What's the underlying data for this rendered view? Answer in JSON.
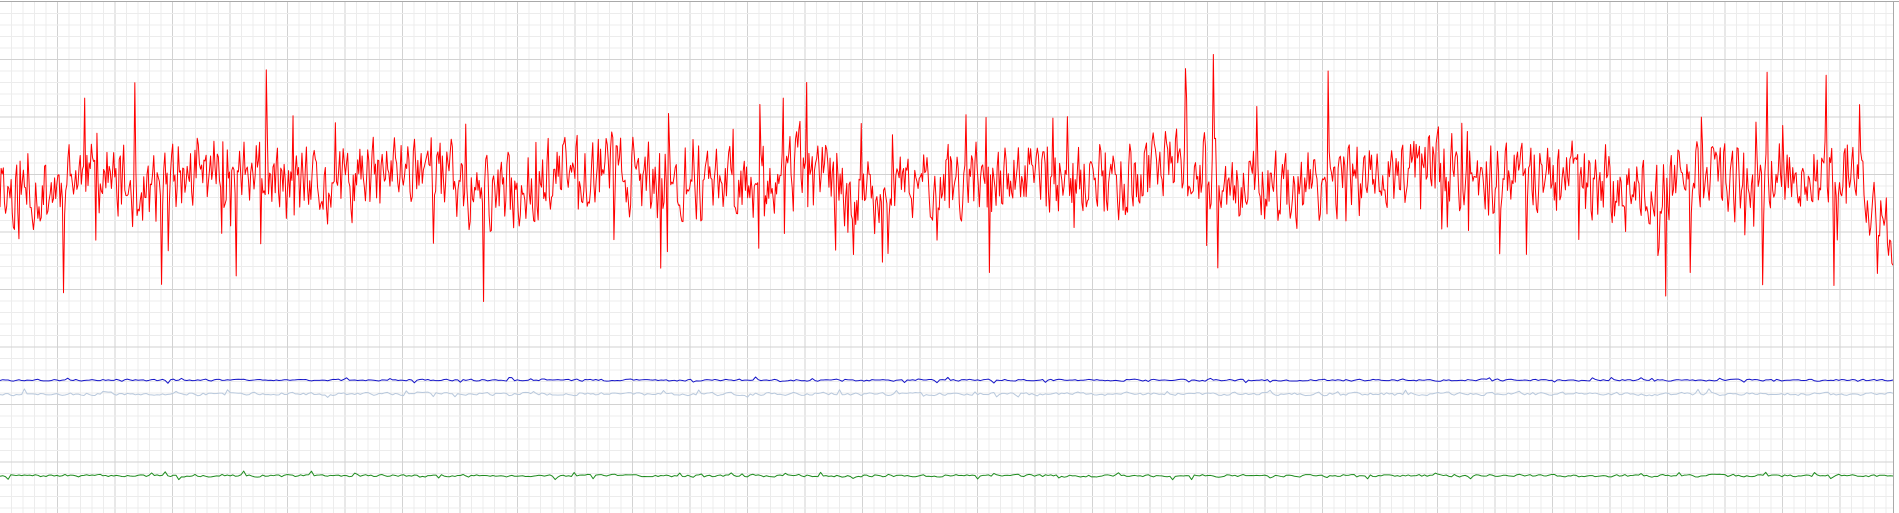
{
  "chart_data": {
    "type": "line",
    "xlabel": "",
    "ylabel": "",
    "xlim": [
      0,
      1000
    ],
    "ylim": [
      0,
      100
    ],
    "grid": true,
    "legend": "none",
    "colors": {
      "grid_minor": "#ececec",
      "grid_major": "#d2d2d2",
      "frame": "#a9a9a9"
    },
    "series": [
      {
        "color": "#ff0000",
        "x": [
          0,
          25,
          50,
          75,
          100,
          125,
          150,
          175,
          200,
          225,
          250,
          275,
          300,
          325,
          350,
          375,
          400,
          425,
          450,
          475,
          500,
          525,
          550,
          575,
          600,
          625,
          650,
          675,
          700,
          725,
          750,
          775,
          800,
          825,
          850,
          875,
          900,
          925,
          950,
          975,
          1000
        ],
        "mean": [
          63,
          63,
          67,
          62,
          66,
          67,
          64,
          63,
          66,
          69,
          62,
          63,
          67,
          68,
          63,
          66,
          65,
          68,
          62,
          63,
          66,
          64,
          65,
          64,
          66,
          68,
          64,
          63,
          65,
          66,
          68,
          65,
          66,
          65,
          64,
          63,
          66,
          65,
          66,
          66,
          55
        ],
        "amplitude": 11,
        "points": 1700,
        "seed": 11
      },
      {
        "color": "#1414c8",
        "x": [
          0,
          1000
        ],
        "mean": [
          26,
          26
        ],
        "amplitude": 0.3,
        "points": 700,
        "seed": 3
      },
      {
        "color": "#b8c8dc",
        "x": [
          0,
          1000
        ],
        "mean": [
          23.3,
          23.3
        ],
        "amplitude": 0.5,
        "points": 700,
        "seed": 5
      },
      {
        "color": "#1e8c1e",
        "x": [
          0,
          1000
        ],
        "mean": [
          7.3,
          7.3
        ],
        "amplitude": 0.4,
        "points": 700,
        "seed": 7
      }
    ]
  }
}
